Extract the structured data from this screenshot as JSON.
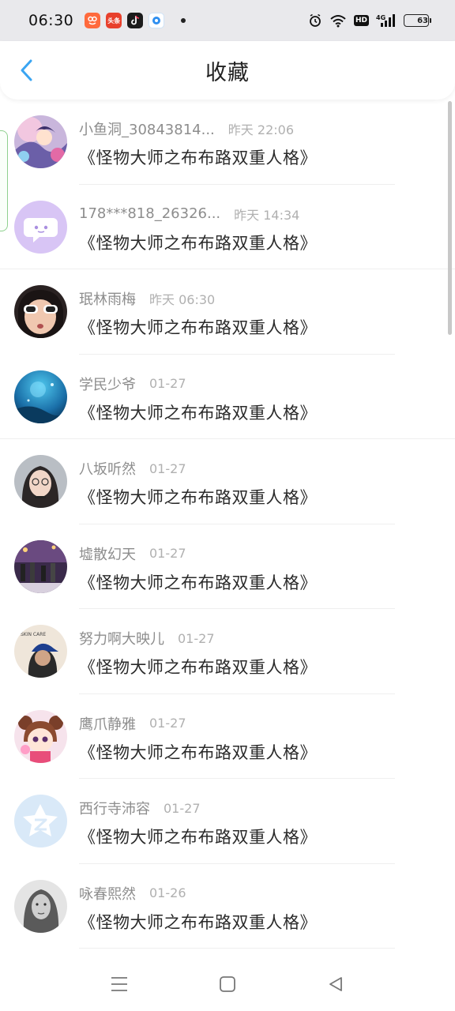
{
  "status_bar": {
    "time": "06:30",
    "apps": [
      {
        "name": "taobao-app-icon",
        "text": "",
        "color": "#ff6a3d"
      },
      {
        "name": "toutiao-app-icon",
        "text": "头条",
        "color": "#e8402c"
      },
      {
        "name": "tiktok-app-icon",
        "text": "",
        "color": "#1b1b1b"
      },
      {
        "name": "browser-app-icon",
        "text": "",
        "color": "#2f8ff0"
      }
    ],
    "network_badge": "HD",
    "signal_label": "4G",
    "battery_level": "63",
    "battery_fraction": 0.63
  },
  "header": {
    "title": "收藏",
    "accent_color": "#3aa5f2"
  },
  "items": [
    {
      "username": "小鱼洞_30843814...",
      "time": "昨天 22:06",
      "content": "《怪物大师之布布路双重人格》",
      "avatar": "anime-avatar"
    },
    {
      "username": "178***818_26326...",
      "time": "昨天 14:34",
      "content": "《怪物大师之布布路双重人格》",
      "avatar": "default-chat-avatar"
    },
    {
      "username": "珉林雨梅",
      "time": "昨天 06:30",
      "content": "《怪物大师之布布路双重人格》",
      "avatar": "child-sunglasses-avatar"
    },
    {
      "username": "学民少爷",
      "time": "01-27",
      "content": "《怪物大师之布布路双重人格》",
      "avatar": "ocean-avatar"
    },
    {
      "username": "八坂听然",
      "time": "01-27",
      "content": "《怪物大师之布布路双重人格》",
      "avatar": "girl-glasses-avatar"
    },
    {
      "username": "墟散幻天",
      "time": "01-27",
      "content": "《怪物大师之布布路双重人格》",
      "avatar": "street-night-avatar"
    },
    {
      "username": "努力啊大映儿",
      "time": "01-27",
      "content": "《怪物大师之布布路双重人格》",
      "avatar": "blue-cap-avatar"
    },
    {
      "username": "鹰爪静雅",
      "time": "01-27",
      "content": "《怪物大师之布布路双重人格》",
      "avatar": "cartoon-girl-avatar"
    },
    {
      "username": "西行寺沛容",
      "time": "01-27",
      "content": "《怪物大师之布布路双重人格》",
      "avatar": "qzone-default-avatar"
    },
    {
      "username": "咏春熙然",
      "time": "01-26",
      "content": "《怪物大师之布布路双重人格》",
      "avatar": "bw-woman-avatar"
    }
  ]
}
